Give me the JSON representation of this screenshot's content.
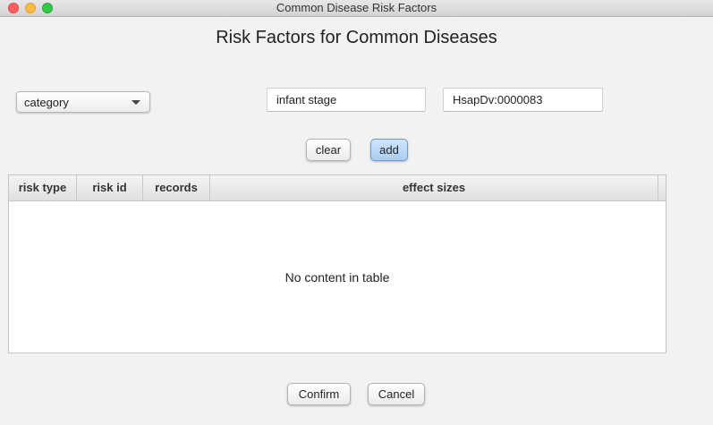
{
  "window": {
    "title": "Common Disease Risk Factors"
  },
  "page": {
    "title": "Risk Factors for Common Diseases"
  },
  "form": {
    "category_select": {
      "selected": "category"
    },
    "stage_input": {
      "value": "infant stage"
    },
    "id_input": {
      "value": "HsapDv:0000083"
    },
    "clear_label": "clear",
    "add_label": "add"
  },
  "table": {
    "columns": [
      "risk type",
      "risk id",
      "records",
      "effect sizes"
    ],
    "rows": [],
    "empty_message": "No content in table"
  },
  "footer": {
    "confirm_label": "Confirm",
    "cancel_label": "Cancel"
  },
  "colors": {
    "background": "#f2f2f2",
    "accent_button": "#a9cdf4",
    "close": "#fc605c",
    "minimize": "#fdbc40",
    "maximize": "#34c84a"
  }
}
